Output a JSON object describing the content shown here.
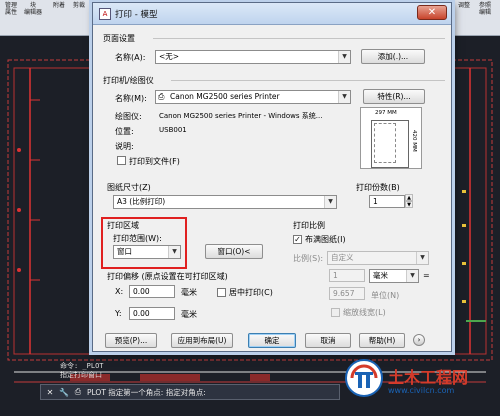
{
  "ribbon": {
    "items": [
      "管理\n属性",
      "块\n编辑器",
      "附着",
      "剪裁",
      "调整",
      "参照\n编辑",
      "编辑"
    ]
  },
  "canvas": {
    "label_left_top": "...",
    "label_marks": [
      "X",
      "X",
      "X"
    ]
  },
  "dialog": {
    "title": "打印 - 模型",
    "close_glyph": "✕",
    "page_setup": {
      "group": "页面设置",
      "name_label": "名称(A):",
      "name_value": "<无>",
      "add_button": "添加(.)..."
    },
    "printer": {
      "group": "打印机/绘图仪",
      "name_label": "名称(M):",
      "name_value": "Canon MG2500 series Printer",
      "properties_button": "特性(R)...",
      "plotter_label": "绘图仪:",
      "plotter_value": "Canon MG2500 series Printer - Windows 系统...",
      "where_label": "位置:",
      "where_value": "USB001",
      "description_label": "说明:",
      "print_to_file_label": "打印到文件(F)",
      "preview_width": "297 MM",
      "preview_height": "420 MM"
    },
    "paper": {
      "group": "图纸尺寸(Z)",
      "value": "A3 (比例打印)"
    },
    "copies": {
      "group": "打印份数(B)",
      "value": "1"
    },
    "area": {
      "group": "打印区域",
      "what_label": "打印范围(W):",
      "what_value": "窗口",
      "window_button": "窗口(O)<"
    },
    "offset": {
      "group": "打印偏移 (原点设置在可打印区域)",
      "x_label": "X:",
      "x_value": "0.00",
      "x_unit": "毫米",
      "y_label": "Y:",
      "y_value": "0.00",
      "y_unit": "毫米",
      "center_label": "居中打印(C)"
    },
    "scale": {
      "group": "打印比例",
      "fit_label": "布满图纸(I)",
      "fit_checked": true,
      "scale_label": "比例(S):",
      "scale_value": "自定义",
      "value1": "1",
      "unit": "毫米",
      "value2": "9.657",
      "unit_label": "单位(N)",
      "lineweights_label": "缩放线宽(L)"
    },
    "buttons": {
      "preview": "预览(P)...",
      "apply_layout": "应用到布局(U)",
      "ok": "确定",
      "cancel": "取消",
      "help": "帮助(H)"
    }
  },
  "command": {
    "history1": "命令: _PLOT",
    "history2": "指定打印窗口",
    "prompt": "PLOT 指定第一个角点: 指定对角点:"
  },
  "watermark": {
    "name": "土木工程网",
    "url": "www.civilcn.com"
  },
  "colors": {
    "dialog_bg": "#f0f0f0",
    "highlight": "#e02020",
    "cad_bg": "#1c1f27",
    "watermark_red": "#d43b2a",
    "watermark_blue": "#1a63b5"
  }
}
